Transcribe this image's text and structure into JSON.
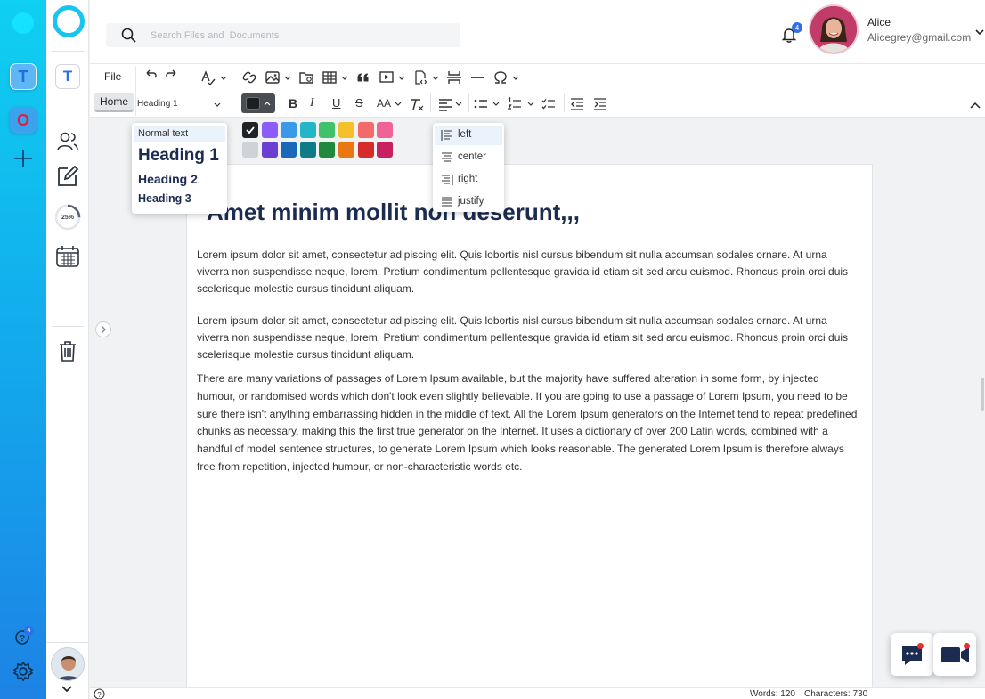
{
  "app": {
    "rail_apps": [
      "T",
      "O"
    ],
    "sidebar_app": "T",
    "progress_label": "25%",
    "progress_fraction": 0.25,
    "help_badge": "4"
  },
  "search": {
    "placeholder": "Search Files and  Documents"
  },
  "notifications": {
    "count": "4"
  },
  "user": {
    "name": "Alice",
    "email": "Alicegrey@gmail.com"
  },
  "toolbar": {
    "file_label": "File",
    "home_label": "Home",
    "style_value": "Heading 1",
    "bold": "B",
    "italic": "I",
    "underline": "U",
    "strike": "S",
    "font_size": "AA",
    "text_color": "#1d1f23"
  },
  "style_menu": {
    "normal": "Normal text",
    "h1": "Heading 1",
    "h2": "Heading 2",
    "h3": "Heading 3"
  },
  "palette": {
    "row1": [
      "#1f2326",
      "#8b5cf6",
      "#3b9ae8",
      "#25b5c9",
      "#3fc26a",
      "#f5c02a",
      "#f46a6a",
      "#ef6396"
    ],
    "row2": [
      "#cfd3d8",
      "#6b3fd1",
      "#1c68b8",
      "#0e7c88",
      "#20883f",
      "#e8780f",
      "#d62b2b",
      "#c92060"
    ],
    "selected": "#1f2326"
  },
  "align_menu": {
    "items": [
      "left",
      "center",
      "right",
      "justify"
    ],
    "selected": "left"
  },
  "document": {
    "title": "Amet minim mollit non deserunt,,,",
    "paragraphs": [
      "Lorem ipsum dolor sit amet, consectetur adipiscing elit. Quis lobortis nisl cursus bibendum sit nulla accumsan sodales ornare. At urna viverra non suspendisse neque, lorem. Pretium condimentum pellentesque gravida id etiam sit sed arcu euismod. Rhoncus proin orci duis scelerisque molestie cursus tincidunt aliquam.",
      "Lorem ipsum dolor sit amet, consectetur adipiscing elit. Quis lobortis nisl cursus bibendum sit nulla accumsan sodales ornare. At urna viverra non suspendisse neque, lorem. Pretium condimentum pellentesque gravida id etiam sit sed arcu euismod. Rhoncus proin orci duis scelerisque molestie cursus tincidunt aliquam.",
      "There are many variations of passages of Lorem Ipsum available, but the majority have suffered alteration in some form, by injected humour, or randomised words which don't look even slightly believable. If you are going to use a passage of Lorem Ipsum, you need to be sure there isn't anything embarrassing hidden in the middle of text. All the Lorem Ipsum generators on the Internet tend to repeat predefined chunks as necessary, making this the first true generator on the Internet. It uses a dictionary of over 200 Latin words, combined with a handful of model sentence structures, to generate Lorem Ipsum which looks reasonable. The generated Lorem Ipsum is therefore always free from repetition, injected humour, or non-characteristic words etc."
    ]
  },
  "status": {
    "words": "Words: 120",
    "characters": "Characters: 730"
  },
  "colors": {
    "accent": "#15c7ef",
    "brand_blue": "#2b6fe0",
    "title": "#1c2b50",
    "alert": "#e53030"
  }
}
